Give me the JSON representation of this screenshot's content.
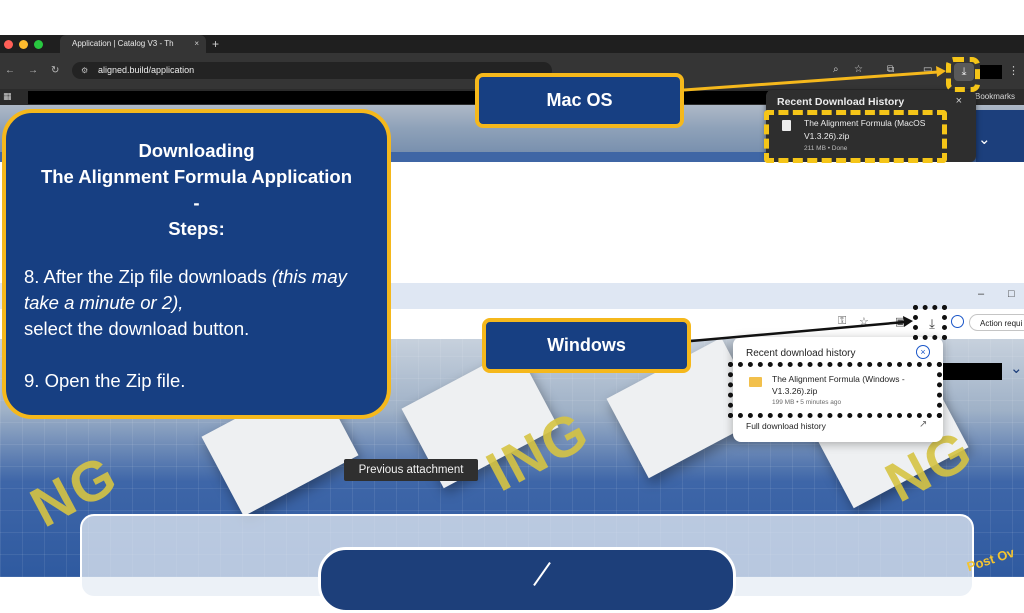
{
  "mac_browser": {
    "tab_title": "Application | Catalog V3 - Th",
    "tab_close": "×",
    "new_tab": "+",
    "url": "aligned.build/application",
    "bookmarks_label": "Bookmarks",
    "download_popover": {
      "title": "Recent Download History",
      "close": "×",
      "file_name": "The Alignment Formula (MacOS V1.3.26).zip",
      "file_meta": "211 MB • Done"
    }
  },
  "windows_browser": {
    "window_controls": {
      "minimize": "–",
      "maximize": "□"
    },
    "action_button": "Action requi",
    "download_popover": {
      "title": "Recent download history",
      "close": "×",
      "file_name": "The Alignment Formula (Windows - V1.3.26).zip",
      "file_meta": "199 MB • 5 minutes ago",
      "full_history": "Full download history"
    },
    "tooltip": "Previous attachment",
    "background_text": "ENGINEERING",
    "corner_text": "Post Ov"
  },
  "callouts": {
    "mac": "Mac OS",
    "windows": "Windows"
  },
  "steps": {
    "title_line1": "Downloading",
    "title_line2": "The Alignment Formula Application",
    "title_sep": "-",
    "title_line3": "Steps:",
    "step8_a": "8. After the Zip file downloads ",
    "step8_italic": "(this may take a minute or 2),",
    "step8_b": "select the download button.",
    "step9": "9. Open the Zip file."
  },
  "colors": {
    "callout_fill": "#173f82",
    "callout_border": "#f5b81c",
    "mac_highlight": "#f5c518",
    "windows_highlight": "#111111"
  }
}
